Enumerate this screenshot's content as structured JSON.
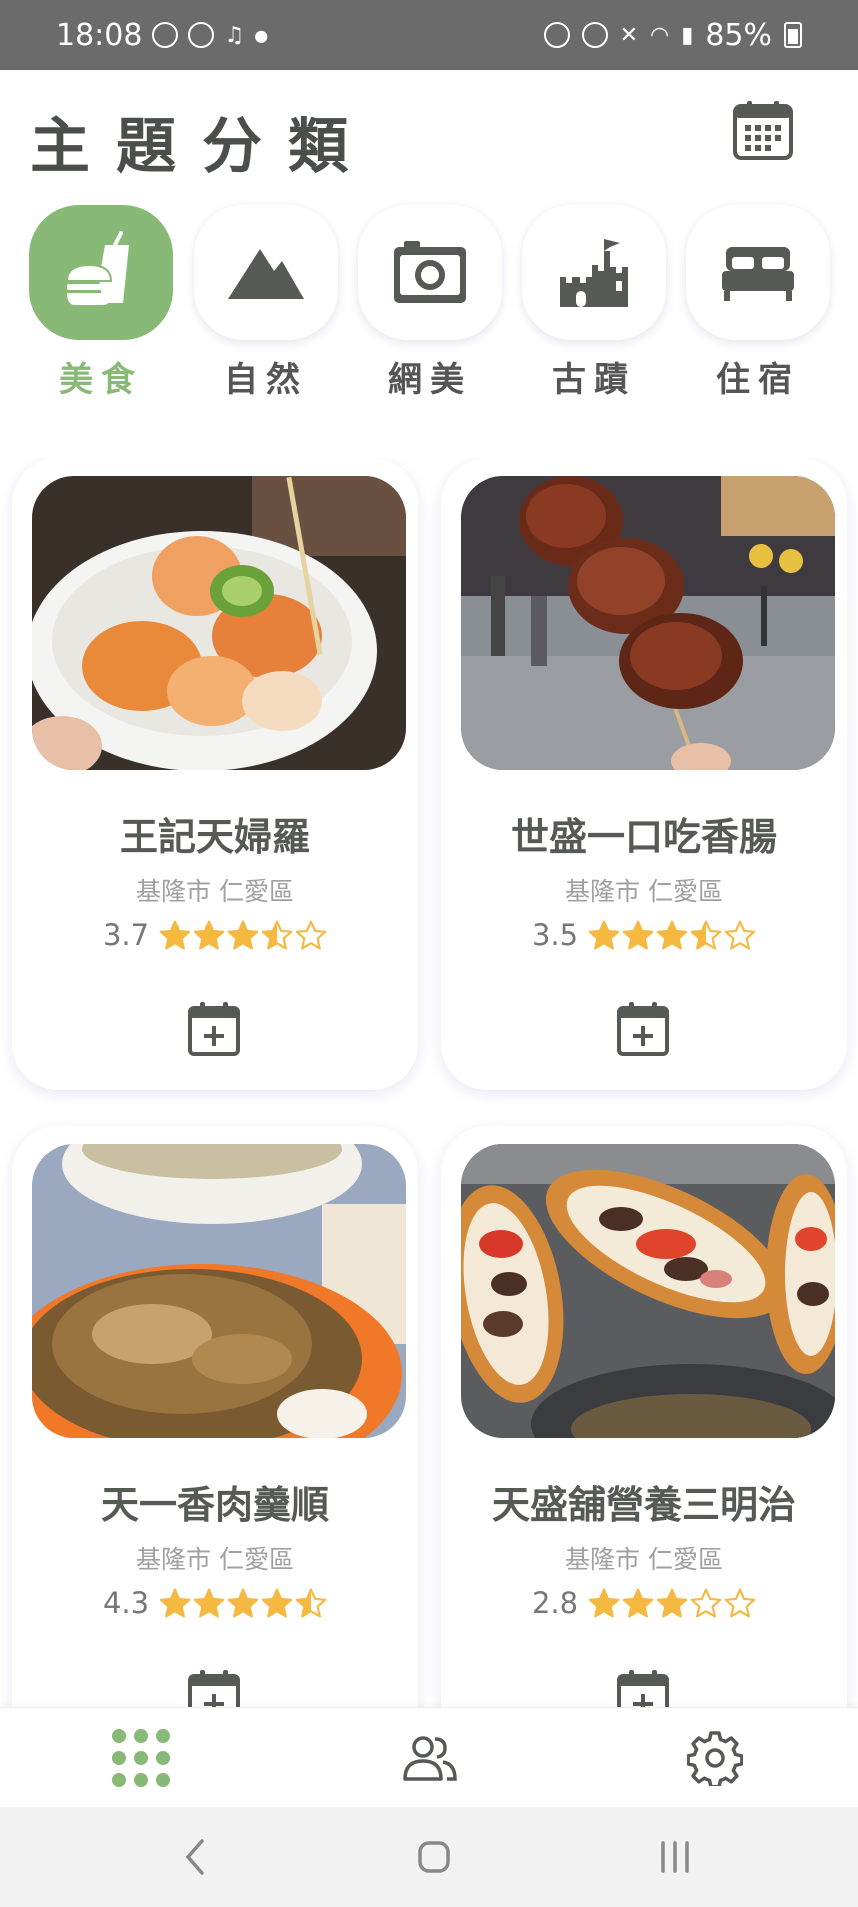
{
  "status_bar": {
    "time": "18:08",
    "battery": "85%"
  },
  "header": {
    "title": "主題分類"
  },
  "categories": [
    {
      "label": "美食",
      "icon": "food-icon",
      "active": true
    },
    {
      "label": "自然",
      "icon": "mountain-icon",
      "active": false
    },
    {
      "label": "網美",
      "icon": "camera-icon",
      "active": false
    },
    {
      "label": "古蹟",
      "icon": "castle-icon",
      "active": false
    },
    {
      "label": "住宿",
      "icon": "bed-icon",
      "active": false
    }
  ],
  "places": [
    {
      "name": "王記天婦羅",
      "location": "基隆市 仁愛區",
      "rating": "3.7",
      "rating_value": 3.7
    },
    {
      "name": "世盛一口吃香腸",
      "location": "基隆市 仁愛區",
      "rating": "3.5",
      "rating_value": 3.5
    },
    {
      "name": "天一香肉羹順",
      "location": "基隆市 仁愛區",
      "rating": "4.3",
      "rating_value": 4.3
    },
    {
      "name": "天盛舖營養三明治",
      "location": "基隆市 仁愛區",
      "rating": "2.8",
      "rating_value": 2.8
    }
  ],
  "colors": {
    "accent": "#88b977",
    "star": "#f5b942",
    "icon": "#555a55"
  },
  "bottom_nav": [
    {
      "icon": "grid-icon",
      "active": true
    },
    {
      "icon": "users-icon",
      "active": false
    },
    {
      "icon": "gear-icon",
      "active": false
    }
  ]
}
